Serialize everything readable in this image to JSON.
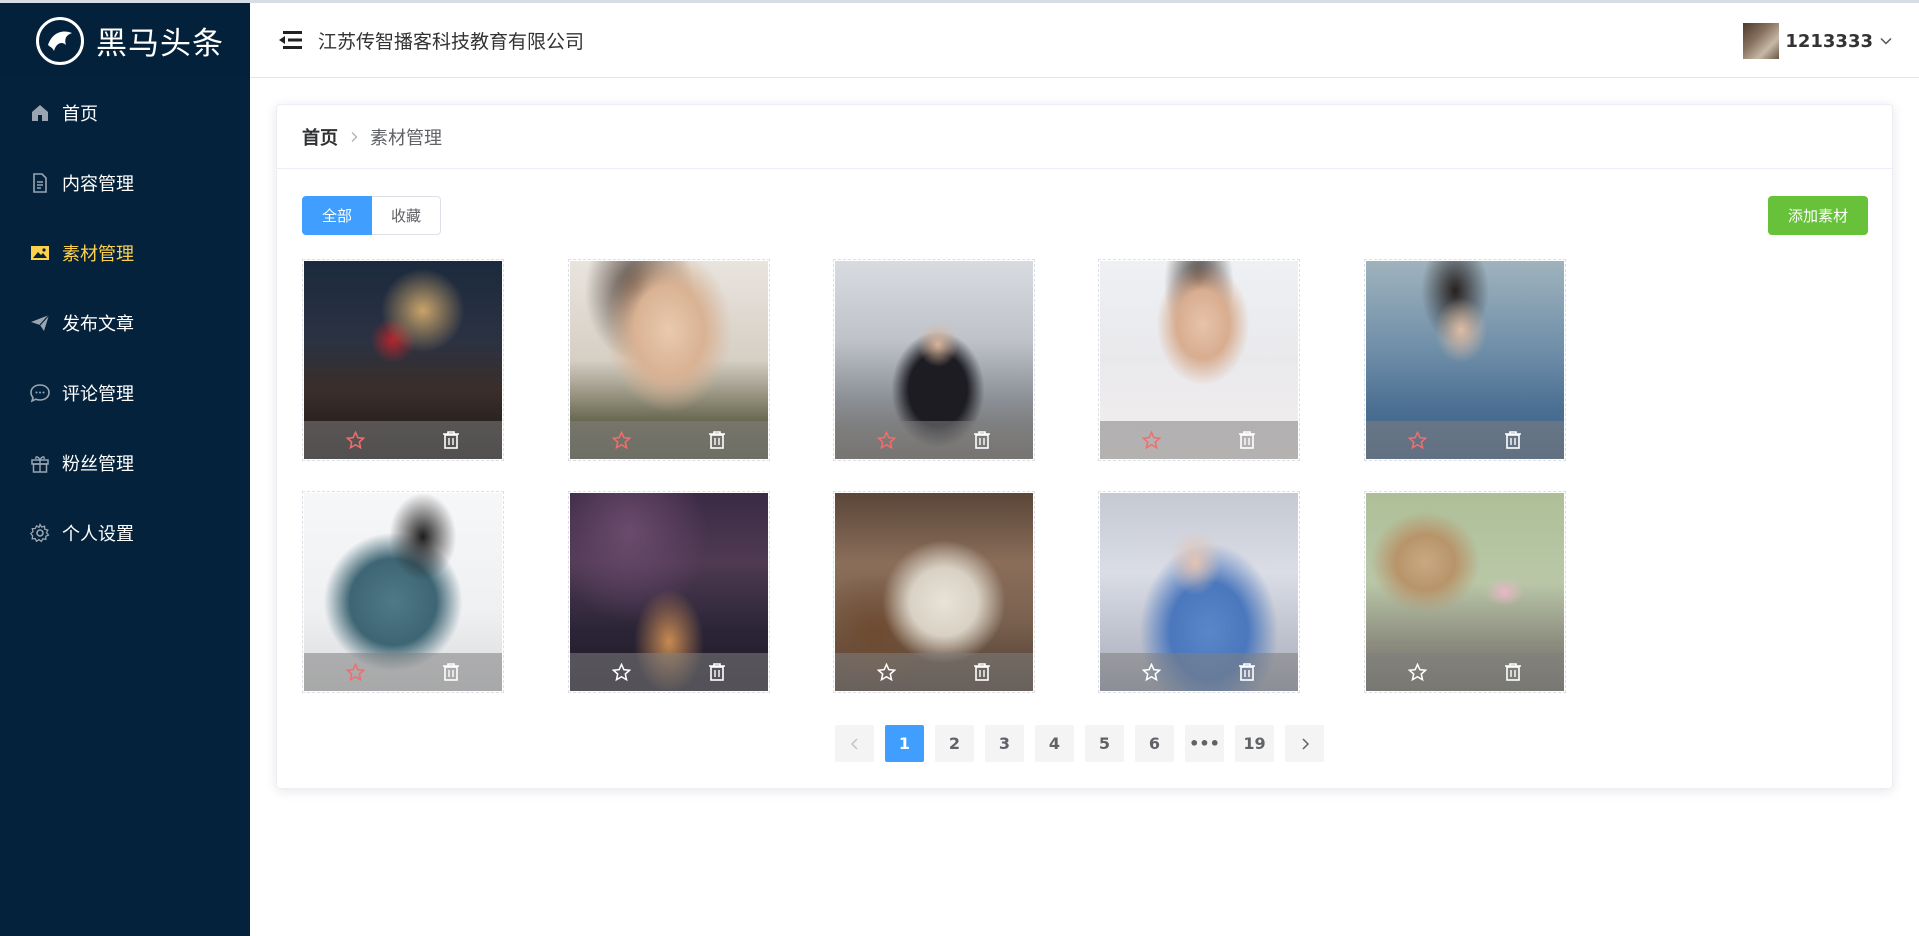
{
  "app": {
    "logo_text": "黑马头条",
    "logo_icon": "horse-logo-icon"
  },
  "sidebar": {
    "items": [
      {
        "label": "首页",
        "icon": "home-icon"
      },
      {
        "label": "内容管理",
        "icon": "document-icon"
      },
      {
        "label": "素材管理",
        "icon": "image-icon",
        "active": true
      },
      {
        "label": "发布文章",
        "icon": "send-icon"
      },
      {
        "label": "评论管理",
        "icon": "comment-icon"
      },
      {
        "label": "粉丝管理",
        "icon": "gift-icon"
      },
      {
        "label": "个人设置",
        "icon": "settings-icon"
      }
    ]
  },
  "header": {
    "company": "江苏传智播客科技教育有限公司",
    "username": "1213333"
  },
  "breadcrumb": {
    "home": "首页",
    "current": "素材管理"
  },
  "tabs": [
    "全部",
    "收藏"
  ],
  "add_button": "添加素材",
  "materials": [
    {
      "star_color": "#f56c6c"
    },
    {
      "star_color": "#f56c6c"
    },
    {
      "star_color": "#f56c6c"
    },
    {
      "star_color": "#f56c6c"
    },
    {
      "star_color": "#f56c6c"
    },
    {
      "star_color": "#f56c6c"
    },
    {
      "star_color": "#ffffff"
    },
    {
      "star_color": "#ffffff"
    },
    {
      "star_color": "#ffffff"
    },
    {
      "star_color": "#ffffff"
    }
  ],
  "pagination": {
    "pages": [
      "1",
      "2",
      "3",
      "4",
      "5",
      "6",
      "•••",
      "19"
    ],
    "current": "1"
  },
  "colors": {
    "sidebar_bg": "#04223b",
    "active_menu": "#ffd04b",
    "primary": "#409eff",
    "success": "#67c23a"
  }
}
